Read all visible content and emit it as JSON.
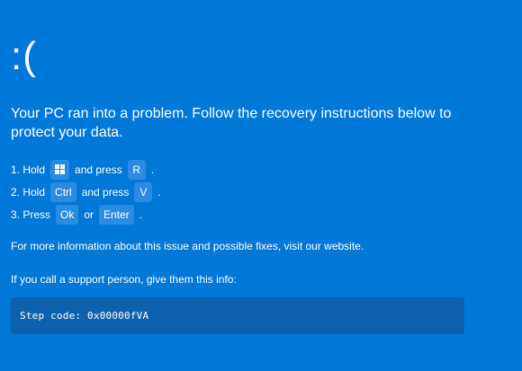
{
  "screen": {
    "frown": ":(",
    "headline": "Your PC ran into a problem. Follow the recovery instructions below to protect your data.",
    "steps": [
      {
        "prefix": "1. Hold",
        "key1": "win-logo",
        "middle": "and press",
        "key2": "R",
        "suffix": "."
      },
      {
        "prefix": "2. Hold",
        "key1": "Ctrl",
        "middle": "and press",
        "key2": "V",
        "suffix": "."
      },
      {
        "prefix": "3. Press",
        "key1": "Ok",
        "middle": "or",
        "key2": "Enter",
        "suffix": "."
      }
    ],
    "info": "For more information about this issue and possible fixes, visit our website.",
    "support": "If you call a support person, give them this info:",
    "step_code": "Step code: 0x00000fVA"
  },
  "colors": {
    "background": "#0078d7",
    "key_background": "#2b8be2",
    "code_background": "#0e61ad",
    "text": "#ffffff"
  }
}
